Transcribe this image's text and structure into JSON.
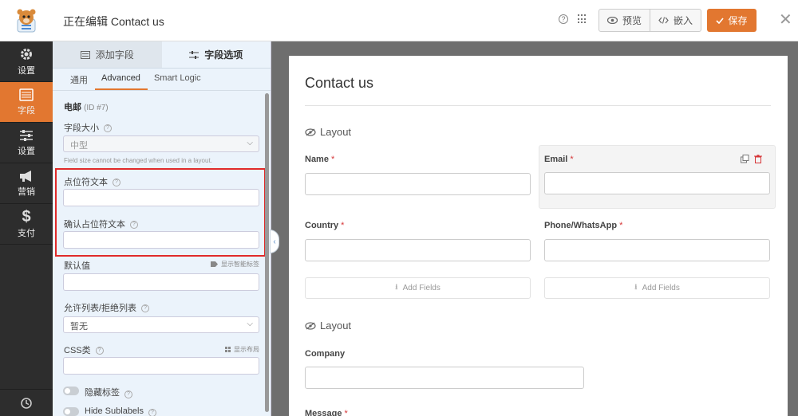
{
  "topbar": {
    "title": "正在编辑 Contact us",
    "preview_label": "预览",
    "embed_label": "嵌入",
    "save_label": "保存",
    "help_glyph": "?"
  },
  "leftnav": {
    "items": [
      {
        "label": "设置",
        "icon": "gear-icon"
      },
      {
        "label": "字段",
        "icon": "fields-list-icon",
        "active": true
      },
      {
        "label": "设置",
        "icon": "sliders-icon"
      },
      {
        "label": "营销",
        "icon": "megaphone-icon"
      },
      {
        "label": "支付",
        "icon": "dollar-icon"
      }
    ],
    "bottom_icon": "history-icon"
  },
  "panel": {
    "tabs": [
      {
        "label": "添加字段",
        "icon": "list-icon"
      },
      {
        "label": "字段选项",
        "icon": "sliders-icon"
      }
    ],
    "subtabs": [
      "通用",
      "Advanced",
      "Smart Logic"
    ],
    "field_name": "电邮",
    "field_id": "(ID #7)",
    "size_label": "字段大小",
    "size_value": "中型",
    "size_note": "Field size cannot be changed when used in a layout.",
    "placeholder_label": "点位符文本",
    "confirm_placeholder_label": "确认占位符文本",
    "default_label": "默认值",
    "smart_tags_link": "显示智能标签",
    "allowlist_label": "允许列表/拒绝列表",
    "allowlist_value": "暂无",
    "css_label": "CSS类",
    "layout_link": "显示布局",
    "hide_label": "隐藏标签",
    "hide_sublabels": "Hide Sublabels"
  },
  "form": {
    "title": "Contact us",
    "layout1": "Layout",
    "layout2": "Layout",
    "required_mark": "*",
    "fields": {
      "name": "Name",
      "email": "Email",
      "country": "Country",
      "phone": "Phone/WhatsApp",
      "company": "Company",
      "message": "Message"
    },
    "add_fields": "Add Fields"
  },
  "colors": {
    "accent": "#e27730",
    "nav_bg": "#2d2d2d",
    "panel_bg": "#ebf3fb",
    "highlight_box": "#e02a2a",
    "required": "#d63638"
  }
}
